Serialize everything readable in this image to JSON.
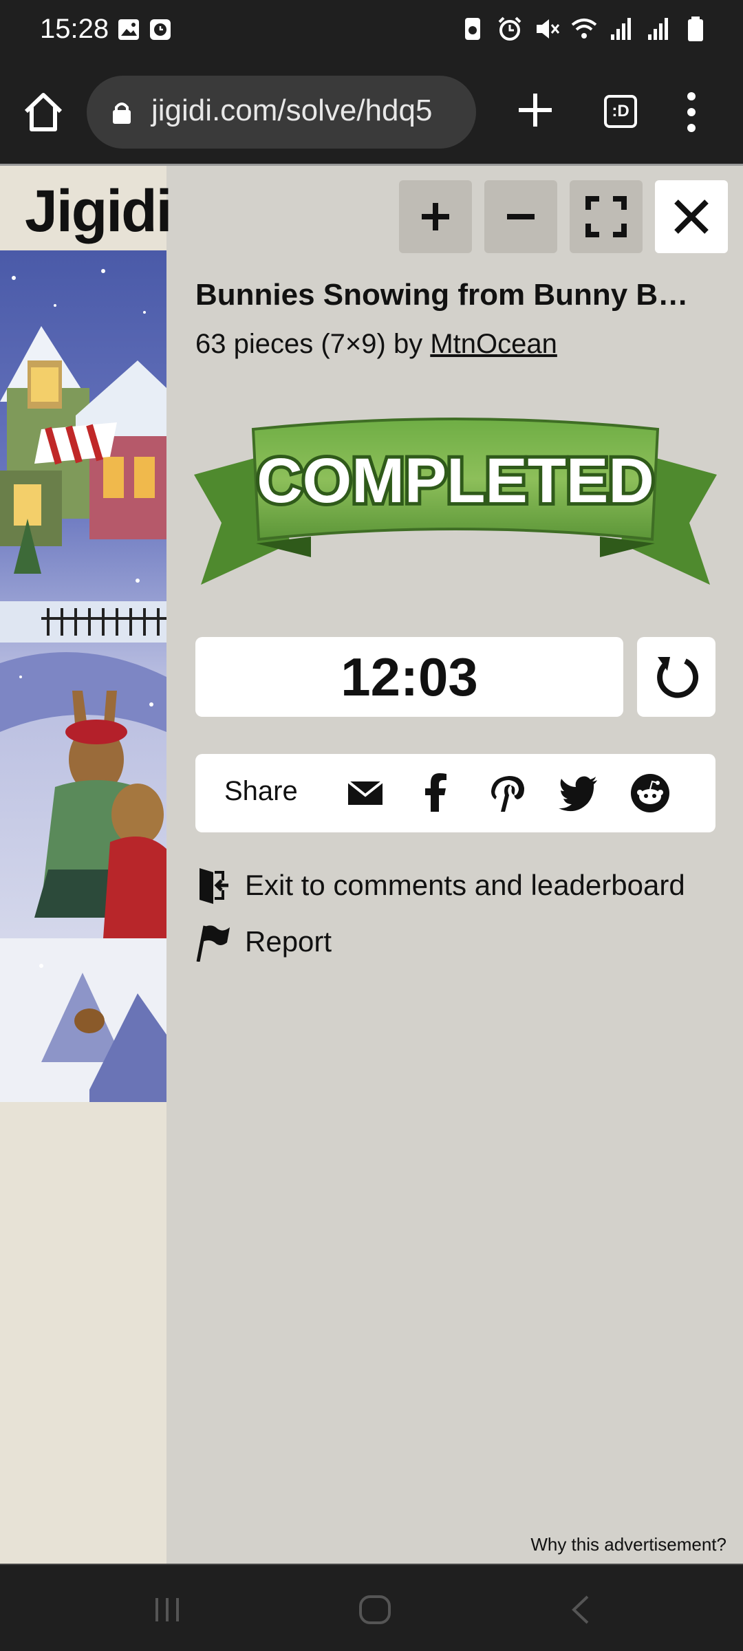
{
  "status_bar": {
    "time": "15:28"
  },
  "browser": {
    "url": "jigidi.com/solve/hdq5",
    "tab_count": ":D"
  },
  "site": {
    "logo": "Jigidi"
  },
  "puzzle": {
    "title": "Bunnies Snowing from Bunny B…",
    "meta_prefix": "63 pieces (7×9) by ",
    "author": "MtnOcean",
    "status_banner": "COMPLETED",
    "timer": "12:03"
  },
  "share": {
    "label": "Share",
    "icons": [
      "email-icon",
      "facebook-icon",
      "pinterest-icon",
      "twitter-icon",
      "reddit-icon"
    ]
  },
  "links": {
    "exit": "Exit to comments and leaderboard",
    "report": "Report"
  },
  "ad": {
    "why": "Why this advertisement?"
  },
  "colors": {
    "banner_green": "#5f9a3a",
    "banner_dark": "#3f6e25",
    "page_bg": "#d3d1cb",
    "left_bg": "#e7e2d6"
  }
}
